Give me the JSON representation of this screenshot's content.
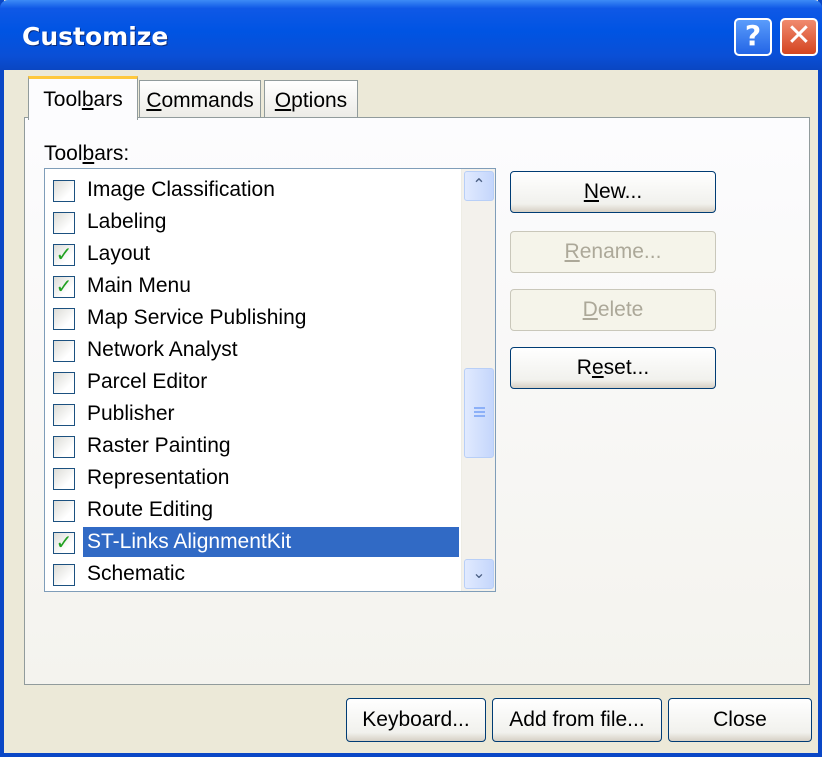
{
  "window": {
    "title": "Customize",
    "help_glyph": "?",
    "close_glyph": "✕"
  },
  "tabs": [
    {
      "pre": "Tool",
      "key": "b",
      "post": "ars"
    },
    {
      "pre": "",
      "key": "C",
      "post": "ommands"
    },
    {
      "pre": "",
      "key": "O",
      "post": "ptions"
    }
  ],
  "toolbars_label": {
    "pre": "Tool",
    "key": "b",
    "post": "ars:"
  },
  "toolbars": [
    {
      "label": "Image Classification",
      "checked": false
    },
    {
      "label": "Labeling",
      "checked": false
    },
    {
      "label": "Layout",
      "checked": true
    },
    {
      "label": "Main Menu",
      "checked": true
    },
    {
      "label": "Map Service Publishing",
      "checked": false
    },
    {
      "label": "Network Analyst",
      "checked": false
    },
    {
      "label": "Parcel Editor",
      "checked": false
    },
    {
      "label": "Publisher",
      "checked": false
    },
    {
      "label": "Raster Painting",
      "checked": false
    },
    {
      "label": "Representation",
      "checked": false
    },
    {
      "label": "Route Editing",
      "checked": false
    },
    {
      "label": "ST-Links AlignmentKit",
      "checked": true
    },
    {
      "label": "Schematic",
      "checked": false
    }
  ],
  "selected_index": 11,
  "scroll": {
    "up_glyph": "⌃",
    "down_glyph": "⌄"
  },
  "check_glyph": "✓",
  "side_buttons": {
    "new": {
      "pre": "",
      "key": "N",
      "post": "ew..."
    },
    "rename": {
      "pre": "",
      "key": "R",
      "post": "ename..."
    },
    "delete": {
      "pre": "",
      "key": "D",
      "post": "elete"
    },
    "reset": {
      "pre": "R",
      "key": "e",
      "post": "set..."
    }
  },
  "bottom_buttons": {
    "keyboard": "Keyboard...",
    "add_from_file": "Add from file...",
    "close": "Close"
  },
  "colors": {
    "title_blue": "#0054E3",
    "selection": "#316AC5",
    "check_green": "#21A121",
    "close_red": "#D44520"
  }
}
